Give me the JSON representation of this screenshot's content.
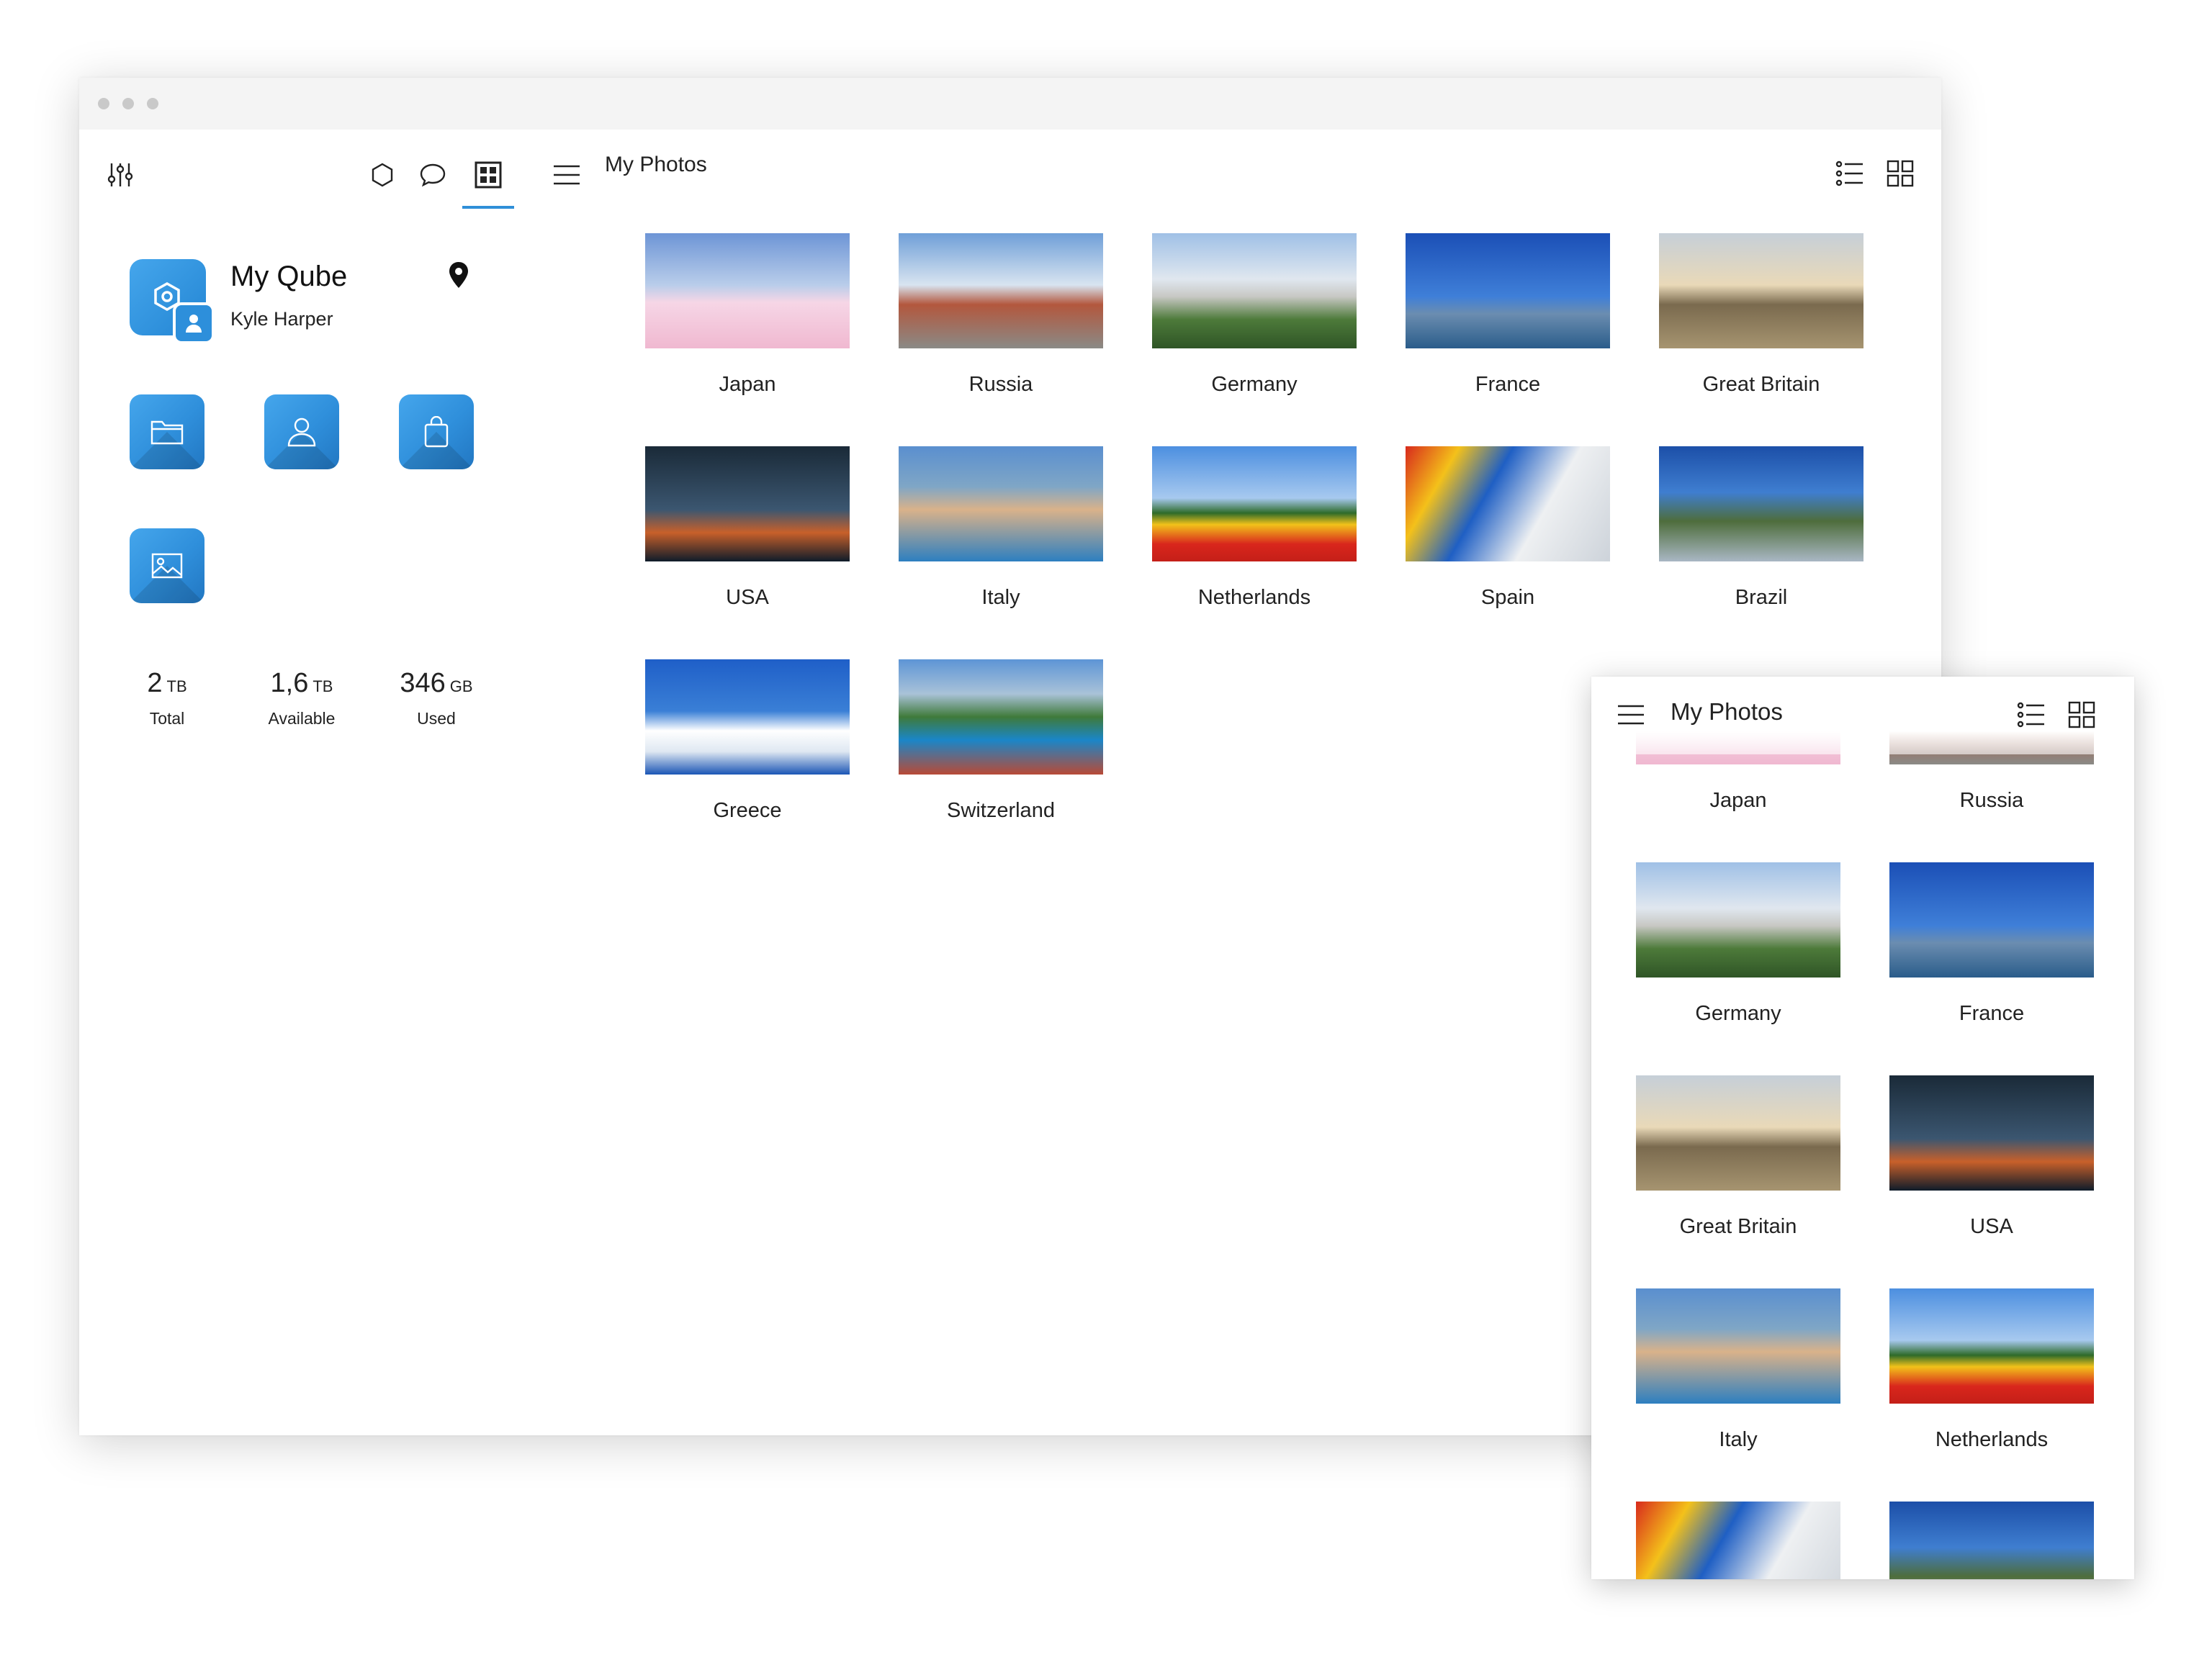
{
  "window": {
    "title_dots": [
      "close",
      "minimize",
      "maximize"
    ],
    "header": {
      "title": "My Photos"
    },
    "toolbar_icons": [
      "settings-sliders-icon",
      "hexagon-icon",
      "chat-icon",
      "grid-app-icon",
      "menu-icon",
      "list-view-icon",
      "grid-view-icon"
    ]
  },
  "profile": {
    "name": "My Qube",
    "user": "Kyle Harper",
    "apps": [
      "folder-icon",
      "contacts-icon",
      "bag-icon",
      "photos-icon"
    ]
  },
  "storage": [
    {
      "value": "2",
      "unit": "TB",
      "label": "Total"
    },
    {
      "value": "1,6",
      "unit": "TB",
      "label": "Available"
    },
    {
      "value": "346",
      "unit": "GB",
      "label": "Used"
    }
  ],
  "photos": [
    {
      "label": "Japan"
    },
    {
      "label": "Russia"
    },
    {
      "label": "Germany"
    },
    {
      "label": "France"
    },
    {
      "label": "Great Britain"
    },
    {
      "label": "USA"
    },
    {
      "label": "Italy"
    },
    {
      "label": "Netherlands"
    },
    {
      "label": "Spain"
    },
    {
      "label": "Brazil"
    },
    {
      "label": "Greece"
    },
    {
      "label": "Switzerland"
    }
  ],
  "mobile": {
    "header": {
      "title": "My Photos"
    },
    "photos": [
      {
        "label": "Japan"
      },
      {
        "label": "Russia"
      },
      {
        "label": "Germany"
      },
      {
        "label": "France"
      },
      {
        "label": "Great Britain"
      },
      {
        "label": "USA"
      },
      {
        "label": "Italy"
      },
      {
        "label": "Netherlands"
      },
      {
        "label": ""
      },
      {
        "label": ""
      }
    ]
  },
  "colors": {
    "accent": "#2f8fd8",
    "tile": "#3a9be4"
  }
}
